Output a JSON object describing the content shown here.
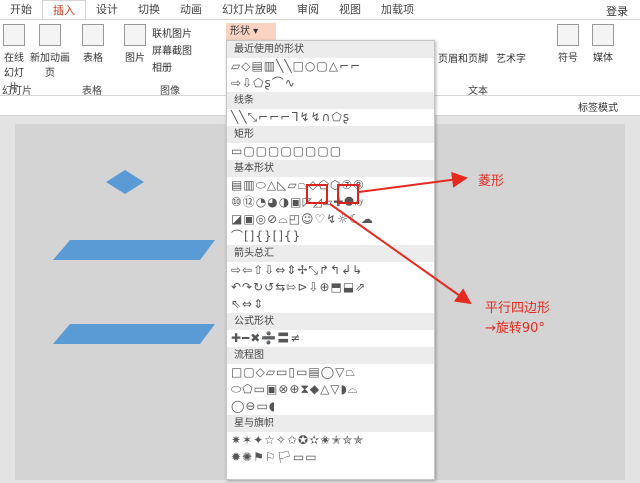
{
  "tabs": [
    "开始",
    "插入",
    "设计",
    "切换",
    "动画",
    "幻灯片放映",
    "审阅",
    "视图",
    "加载项"
  ],
  "active_tab": "插入",
  "login": "登录",
  "ribbon": {
    "slides": {
      "items": [
        "在线幻灯片",
        "新加动画页"
      ],
      "group": "幻灯片"
    },
    "table": {
      "item": "表格",
      "group": "表格"
    },
    "images": {
      "picture": "图片",
      "online": "联机图片",
      "screenshot": "屏幕截图",
      "album": "相册",
      "group": "图像"
    },
    "shapes_button": "形状",
    "text": {
      "header_footer": "页眉和页脚",
      "wordart": "艺术字",
      "group": "文本"
    },
    "symbol": "符号",
    "media": "媒体"
  },
  "subbar": {
    "tag_mode": "标签模式"
  },
  "panel": {
    "sections": [
      {
        "title": "最近使用的形状",
        "rows": [
          "▱◇▤▥╲╲□○▢△⌐⌐",
          "⇨⇩⬠ʂ⌒∿"
        ]
      },
      {
        "title": "线条",
        "rows": [
          "╲╲⤡⌐⌐⌐ᒣ↯↯∩⬠ʂ"
        ]
      },
      {
        "title": "矩形",
        "rows": [
          "▭▢▢▢▢▢▢▢▢"
        ]
      },
      {
        "title": "基本形状",
        "rows": [
          "▤▥⬭△◺▱⏢◇⬠⬡⑦⑧",
          "⑩⑫◔◕◑▣◸◿▱✚⯃⌭",
          "◪▣◎⊘⌓◰☺♡↯☼☾☁",
          "⌒[]{}[]{}"
        ]
      },
      {
        "title": "箭头总汇",
        "rows": [
          "⇨⇦⇧⇩⇔⇕✢⤡↱↰↲↳",
          "↶↷↻↺⇆⇰⊳⇩⊕⬒⬓⇗",
          "⇖⇔⇕"
        ]
      },
      {
        "title": "公式形状",
        "rows": [
          "✚━✖➗〓≠"
        ]
      },
      {
        "title": "流程图",
        "rows": [
          "□▢◇▱▭▯▭▤◯▽⏢",
          "⬭⬠▭▣⊗⊕⧗◆△▽◗⌓",
          "◯⊖▭◖"
        ]
      },
      {
        "title": "星与旗帜",
        "rows": [
          "✷✶✦☆✧✩✪✫✬✭✮✯",
          "✹✺⚑⚐🏳▭▭"
        ]
      }
    ]
  },
  "annotations": {
    "diamond": "菱形",
    "parallelogram": "平行四边形",
    "rotate": "→旋转90°"
  },
  "colors": {
    "accent": "#c43e1c",
    "shape_fill": "#5b9bd5",
    "annotation": "#e52a1f"
  }
}
